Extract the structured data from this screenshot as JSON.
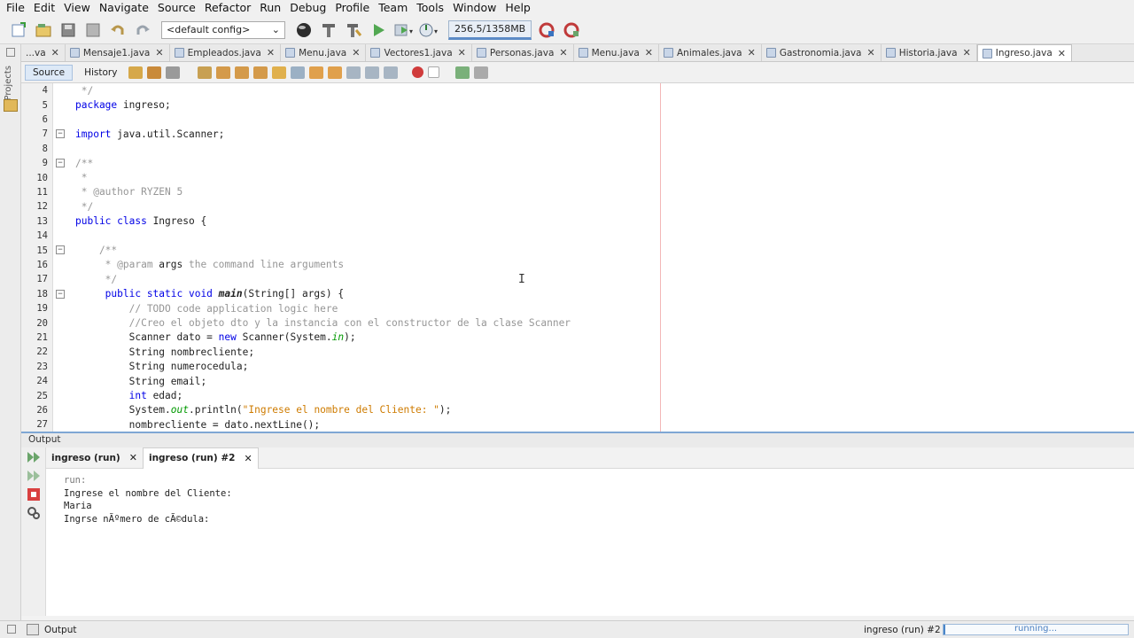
{
  "menu": [
    "File",
    "Edit",
    "View",
    "Navigate",
    "Source",
    "Refactor",
    "Run",
    "Debug",
    "Profile",
    "Team",
    "Tools",
    "Window",
    "Help"
  ],
  "toolbar": {
    "config": "<default config>",
    "memory": "256,5/1358MB",
    "icons": [
      "new-project-icon",
      "open-project-icon",
      "save-all-icon",
      "undo-icon",
      "redo-icon",
      "build-icon",
      "clean-build-icon",
      "run-icon",
      "debug-icon",
      "profile-icon"
    ]
  },
  "tabs": [
    {
      "label": "...va",
      "active": false
    },
    {
      "label": "Mensaje1.java",
      "active": false
    },
    {
      "label": "Empleados.java",
      "active": false
    },
    {
      "label": "Menu.java",
      "active": false
    },
    {
      "label": "Vectores1.java",
      "active": false
    },
    {
      "label": "Personas.java",
      "active": false
    },
    {
      "label": "Menu.java",
      "active": false
    },
    {
      "label": "Animales.java",
      "active": false
    },
    {
      "label": "Gastronomia.java",
      "active": false
    },
    {
      "label": "Historia.java",
      "active": false
    },
    {
      "label": "Ingreso.java",
      "active": true
    }
  ],
  "editor_tabs": {
    "source": "Source",
    "history": "History"
  },
  "left_panel": {
    "projects": "Projects"
  },
  "code": [
    {
      "n": "4",
      "fold": false,
      "t": [
        {
          "c": "cm",
          "s": " */"
        }
      ]
    },
    {
      "n": "5",
      "fold": false,
      "t": [
        {
          "c": "kw",
          "s": "package"
        },
        {
          "c": "",
          "s": " ingreso;"
        }
      ]
    },
    {
      "n": "6",
      "fold": false,
      "t": []
    },
    {
      "n": "7",
      "fold": true,
      "t": [
        {
          "c": "kw",
          "s": "import"
        },
        {
          "c": "",
          "s": " java.util.Scanner;"
        }
      ]
    },
    {
      "n": "8",
      "fold": false,
      "t": []
    },
    {
      "n": "9",
      "fold": true,
      "t": [
        {
          "c": "cm",
          "s": "/**"
        }
      ]
    },
    {
      "n": "10",
      "fold": false,
      "t": [
        {
          "c": "cm",
          "s": " *"
        }
      ]
    },
    {
      "n": "11",
      "fold": false,
      "t": [
        {
          "c": "cm",
          "s": " * @author RYZEN 5"
        }
      ]
    },
    {
      "n": "12",
      "fold": false,
      "t": [
        {
          "c": "cm",
          "s": " */"
        }
      ]
    },
    {
      "n": "13",
      "fold": false,
      "t": [
        {
          "c": "kw",
          "s": "public class"
        },
        {
          "c": "",
          "s": " Ingreso {"
        }
      ]
    },
    {
      "n": "14",
      "fold": false,
      "t": []
    },
    {
      "n": "15",
      "fold": true,
      "t": [
        {
          "c": "cm",
          "s": "    /**"
        }
      ]
    },
    {
      "n": "16",
      "fold": false,
      "t": [
        {
          "c": "cm",
          "s": "     * @param "
        },
        {
          "c": "",
          "s": "args"
        },
        {
          "c": "cm",
          "s": " the command line arguments"
        }
      ]
    },
    {
      "n": "17",
      "fold": false,
      "t": [
        {
          "c": "cm",
          "s": "     */"
        }
      ]
    },
    {
      "n": "18",
      "fold": true,
      "t": [
        {
          "c": "kw",
          "s": "     public static void"
        },
        {
          "c": "bold it",
          "s": " main"
        },
        {
          "c": "",
          "s": "(String[] args) {"
        }
      ]
    },
    {
      "n": "19",
      "fold": false,
      "t": [
        {
          "c": "cm",
          "s": "         // TODO code application logic here"
        }
      ]
    },
    {
      "n": "20",
      "fold": false,
      "t": [
        {
          "c": "cm",
          "s": "         //Creo el objeto dto y la instancia con el constructor de la clase Scanner"
        }
      ]
    },
    {
      "n": "21",
      "fold": false,
      "t": [
        {
          "c": "",
          "s": "         Scanner dato = "
        },
        {
          "c": "kw",
          "s": "new"
        },
        {
          "c": "",
          "s": " Scanner(System."
        },
        {
          "c": "fld",
          "s": "in"
        },
        {
          "c": "",
          "s": ");"
        }
      ]
    },
    {
      "n": "22",
      "fold": false,
      "t": [
        {
          "c": "",
          "s": "         String nombrecliente;"
        }
      ]
    },
    {
      "n": "23",
      "fold": false,
      "t": [
        {
          "c": "",
          "s": "         String numerocedula;"
        }
      ]
    },
    {
      "n": "24",
      "fold": false,
      "t": [
        {
          "c": "",
          "s": "         String email;"
        }
      ]
    },
    {
      "n": "25",
      "fold": false,
      "t": [
        {
          "c": "kw",
          "s": "         int"
        },
        {
          "c": "",
          "s": " edad;"
        }
      ]
    },
    {
      "n": "26",
      "fold": false,
      "t": [
        {
          "c": "",
          "s": "         System."
        },
        {
          "c": "fld",
          "s": "out"
        },
        {
          "c": "",
          "s": ".println("
        },
        {
          "c": "st",
          "s": "\"Ingrese el nombre del Cliente: \""
        },
        {
          "c": "",
          "s": ");"
        }
      ]
    },
    {
      "n": "27",
      "fold": false,
      "t": [
        {
          "c": "",
          "s": "         nombrecliente = dato.nextLine();"
        }
      ]
    }
  ],
  "output": {
    "header": "Output",
    "tabs": [
      {
        "label": "ingreso (run)",
        "active": false
      },
      {
        "label": "ingreso (run) #2",
        "active": true
      }
    ],
    "lines": [
      "run:",
      "Ingrese el nombre del Cliente:",
      "Maria",
      "Ingrse nÃºmero de cÃ©dula:"
    ]
  },
  "status": {
    "output_label": "Output",
    "process": "ingreso (run) #2",
    "progress_text": "running..."
  }
}
